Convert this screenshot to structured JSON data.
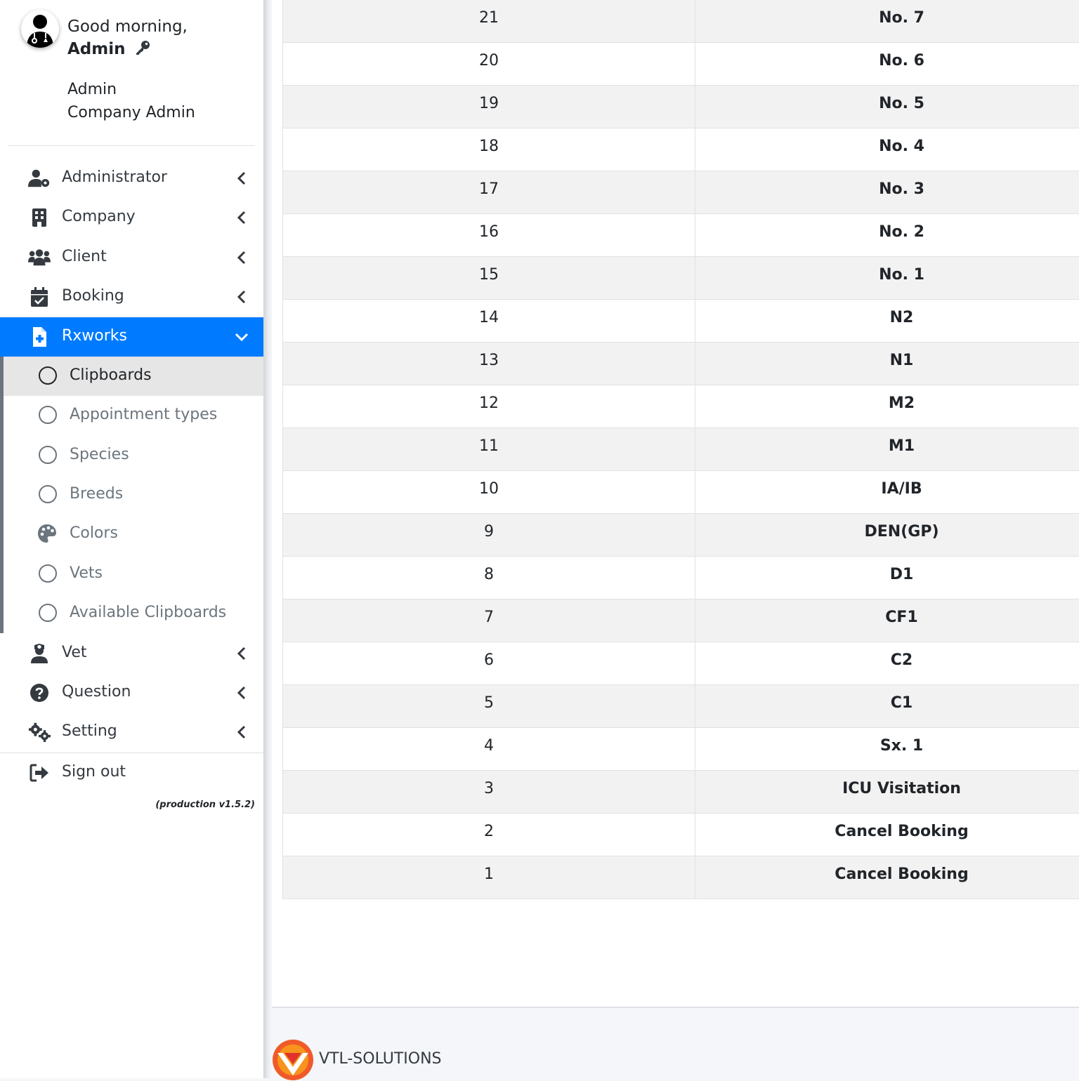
{
  "user": {
    "greeting": "Good morning,",
    "name": "Admin",
    "role_line1": "Admin",
    "role_line2": "Company Admin"
  },
  "sidebar": {
    "items": [
      {
        "label": "Administrator",
        "icon": "user-gear-icon"
      },
      {
        "label": "Company",
        "icon": "building-icon"
      },
      {
        "label": "Client",
        "icon": "users-icon"
      },
      {
        "label": "Booking",
        "icon": "calendar-check-icon"
      },
      {
        "label": "Rxworks",
        "icon": "file-medical-icon",
        "active": true
      },
      {
        "label": "Vet",
        "icon": "user-nurse-icon"
      },
      {
        "label": "Question",
        "icon": "question-circle-icon"
      },
      {
        "label": "Setting",
        "icon": "cogs-icon"
      }
    ],
    "submenu": [
      {
        "label": "Clipboards",
        "icon": "circle-icon",
        "selected": true
      },
      {
        "label": "Appointment types",
        "icon": "circle-icon"
      },
      {
        "label": "Species",
        "icon": "circle-icon"
      },
      {
        "label": "Breeds",
        "icon": "circle-icon"
      },
      {
        "label": "Colors",
        "icon": "palette-icon"
      },
      {
        "label": "Vets",
        "icon": "circle-icon"
      },
      {
        "label": "Available Clipboards",
        "icon": "circle-icon"
      }
    ],
    "signout": {
      "label": "Sign out",
      "icon": "sign-out-icon"
    },
    "version": "(production v1.5.2)"
  },
  "table": {
    "rows": [
      {
        "id": "21",
        "name": "No. 7"
      },
      {
        "id": "20",
        "name": "No. 6"
      },
      {
        "id": "19",
        "name": "No. 5"
      },
      {
        "id": "18",
        "name": "No. 4"
      },
      {
        "id": "17",
        "name": "No. 3"
      },
      {
        "id": "16",
        "name": "No. 2"
      },
      {
        "id": "15",
        "name": "No. 1"
      },
      {
        "id": "14",
        "name": "N2"
      },
      {
        "id": "13",
        "name": "N1"
      },
      {
        "id": "12",
        "name": "M2"
      },
      {
        "id": "11",
        "name": "M1"
      },
      {
        "id": "10",
        "name": "IA/IB"
      },
      {
        "id": "9",
        "name": "DEN(GP)"
      },
      {
        "id": "8",
        "name": "D1"
      },
      {
        "id": "7",
        "name": "CF1"
      },
      {
        "id": "6",
        "name": "C2"
      },
      {
        "id": "5",
        "name": "C1"
      },
      {
        "id": "4",
        "name": "Sx. 1"
      },
      {
        "id": "3",
        "name": "ICU Visitation"
      },
      {
        "id": "2",
        "name": "Cancel Booking"
      },
      {
        "id": "1",
        "name": "Cancel Booking"
      }
    ]
  },
  "footer": {
    "brand": "VTL-SOLUTIONS"
  },
  "colors": {
    "active": "#007bff",
    "stripe": "#f2f2f2",
    "logo_orange": "#f05a28"
  }
}
